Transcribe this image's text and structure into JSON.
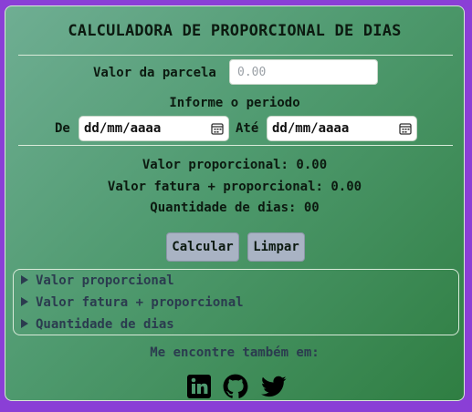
{
  "title": "CALCULADORA DE PROPORCIONAL DE DIAS",
  "parcela": {
    "label": "Valor da parcela",
    "placeholder": "0.00"
  },
  "periodo": {
    "heading": "Informe o periodo",
    "from_label": "De",
    "from_value": "dd/mm/aaaa",
    "to_label": "Até",
    "to_value": "dd/mm/aaaa"
  },
  "results": {
    "proporcional": "Valor proporcional: 0.00",
    "fatura": "Valor fatura + proporcional: 0.00",
    "dias": "Quantidade de dias: 00"
  },
  "buttons": {
    "calcular": "Calcular",
    "limpar": "Limpar"
  },
  "details": [
    {
      "label": "Valor proporcional"
    },
    {
      "label": "Valor fatura + proporcional"
    },
    {
      "label": "Quantidade de dias"
    }
  ],
  "footer": {
    "text": "Me encontre também em:",
    "social": [
      {
        "icon": "linkedin-icon"
      },
      {
        "icon": "github-icon"
      },
      {
        "icon": "twitter-icon"
      }
    ]
  },
  "colors": {
    "background": "#8a3fd6",
    "card_gradient_start": "#6fae93",
    "card_gradient_end": "#2f7e42",
    "button": "#a9b3c4"
  }
}
